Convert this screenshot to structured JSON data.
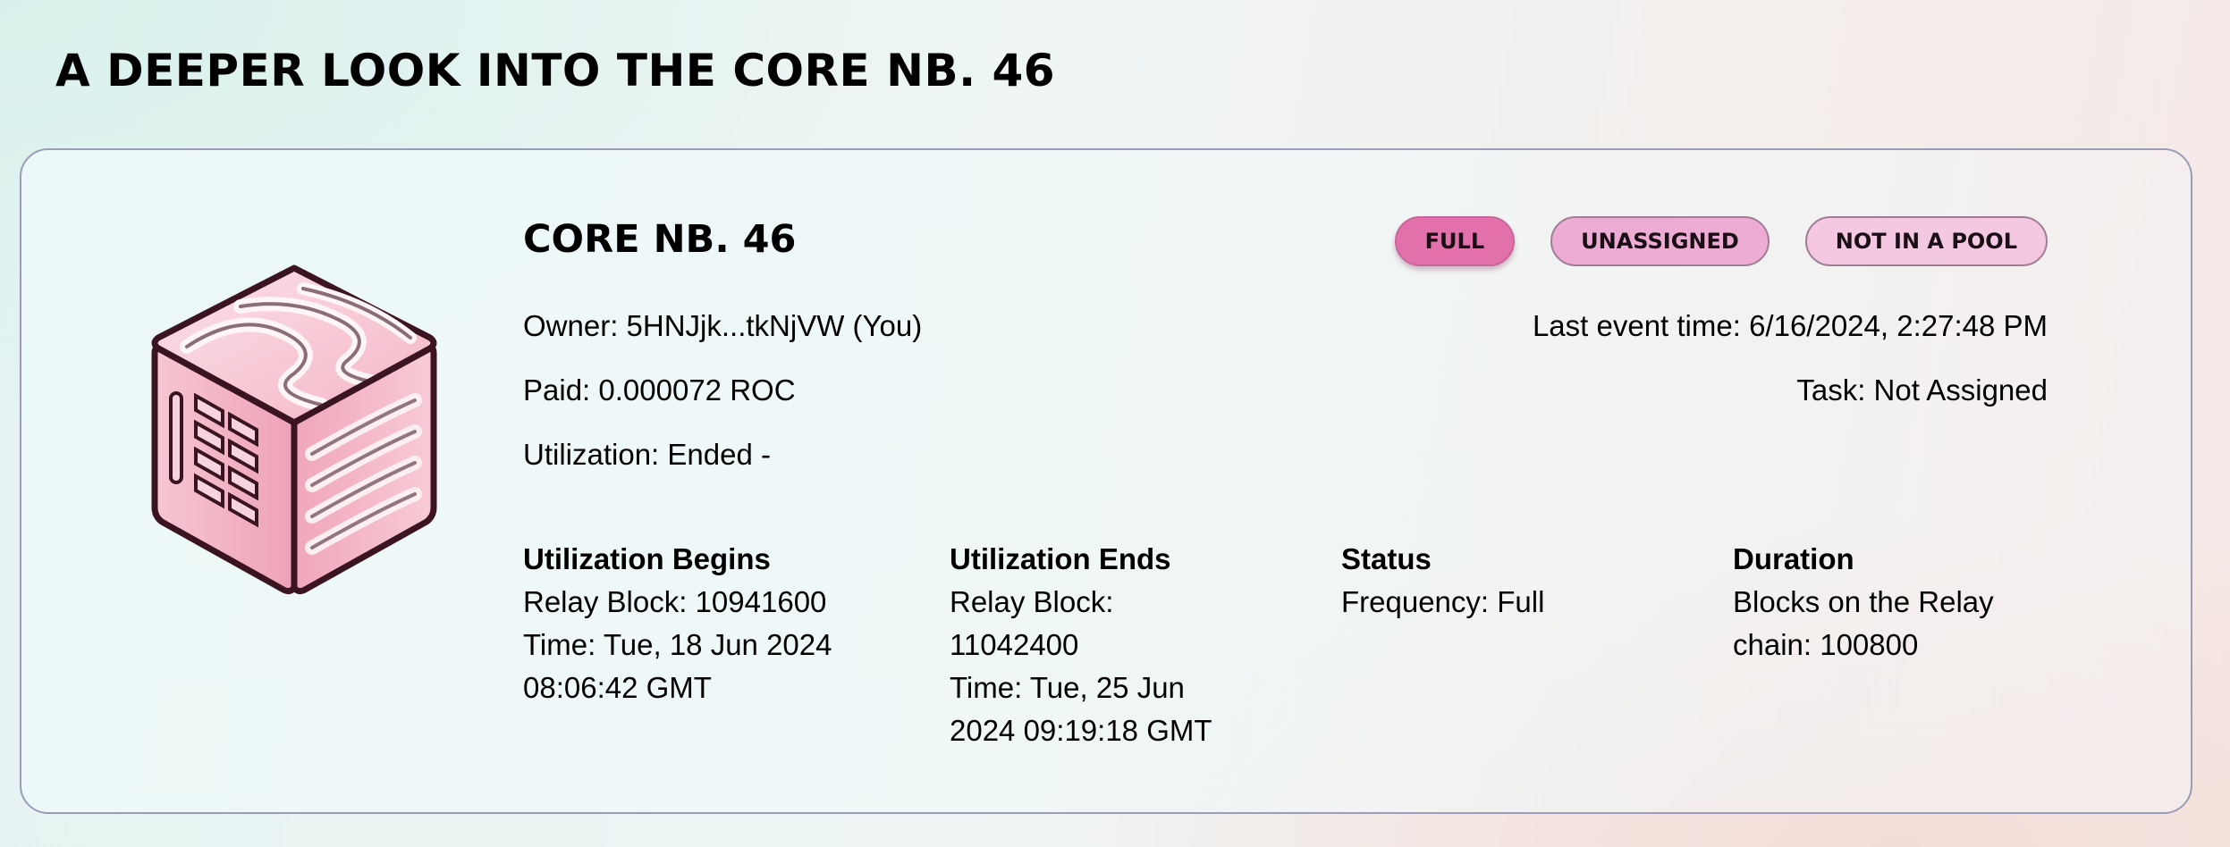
{
  "page": {
    "title": "A DEEPER LOOK INTO THE CORE NB. 46"
  },
  "core": {
    "title": "CORE NB. 46",
    "badges": {
      "full": "FULL",
      "unassigned": "UNASSIGNED",
      "pool": "NOT IN A POOL"
    },
    "owner": "Owner: 5HNJjk...tkNjVW (You)",
    "paid": "Paid: 0.000072 ROC",
    "utilization": "Utilization: Ended -",
    "last_event": "Last event time: 6/16/2024, 2:27:48 PM",
    "task": "Task: Not Assigned"
  },
  "details": {
    "begins": {
      "heading": "Utilization Begins",
      "lines": [
        "Relay Block: 10941600",
        "Time: Tue, 18 Jun 2024",
        "08:06:42 GMT"
      ]
    },
    "ends": {
      "heading": "Utilization Ends",
      "lines": [
        "Relay Block:",
        "11042400",
        "Time: Tue, 25 Jun",
        "2024 09:19:18 GMT"
      ]
    },
    "status": {
      "heading": "Status",
      "lines": [
        "Frequency: Full"
      ]
    },
    "duration": {
      "heading": "Duration",
      "lines": [
        "Blocks on the Relay",
        "chain: 100800"
      ]
    }
  },
  "colors": {
    "accent": "#e271ab",
    "badge_light": "#edacd3",
    "badge_lighter": "#f3c8e0",
    "card_border": "#9a9cb8"
  },
  "icons": {
    "core": "core-cube-icon"
  }
}
